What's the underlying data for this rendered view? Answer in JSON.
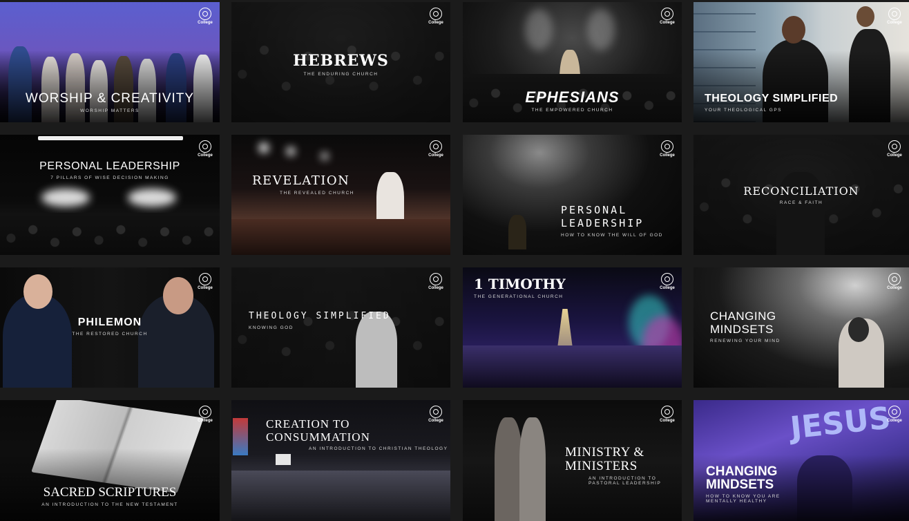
{
  "logo": {
    "label": "College"
  },
  "cards": [
    {
      "title": "WORSHIP & CREATIVITY",
      "subtitle": "WORSHIP MATTERS"
    },
    {
      "title": "HEBREWS",
      "subtitle": "THE ENDURING CHURCH"
    },
    {
      "title": "EPHESIANS",
      "subtitle": "THE EMPOWERED CHURCH"
    },
    {
      "title": "THEOLOGY SIMPLIFIED",
      "subtitle": "YOUR THEOLOGICAL GPS"
    },
    {
      "title": "PERSONAL LEADERSHIP",
      "subtitle": "7 PILLARS OF WISE DECISION MAKING"
    },
    {
      "title": "REVELATION",
      "subtitle": "THE REVEALED CHURCH"
    },
    {
      "title": "PERSONAL LEADERSHIP",
      "subtitle": "HOW TO KNOW THE WILL OF GOD"
    },
    {
      "title": "RECONCILIATION",
      "subtitle": "RACE & FAITH"
    },
    {
      "title": "PHILEMON",
      "subtitle": "THE RESTORED CHURCH"
    },
    {
      "title": "THEOLOGY SIMPLIFIED",
      "subtitle": "KNOWING GOD"
    },
    {
      "title": "1 TIMOTHY",
      "subtitle": "THE GENERATIONAL CHURCH"
    },
    {
      "title": "CHANGING MINDSETS",
      "subtitle": "RENEWING YOUR MIND"
    },
    {
      "title": "SACRED SCRIPTURES",
      "subtitle": "AN INTRODUCTION TO THE NEW TESTAMENT"
    },
    {
      "title": "CREATION TO CONSUMMATION",
      "subtitle": "AN INTRODUCTION TO CHRISTIAN THEOLOGY"
    },
    {
      "title": "MINISTRY & MINISTERS",
      "subtitle": "AN INTRODUCTION TO PASTORAL LEADERSHIP"
    },
    {
      "title": "CHANGING MINDSETS",
      "subtitle": "HOW TO KNOW YOU ARE MENTALLY HEALTHY",
      "background_text": "JESUS"
    }
  ],
  "colors": {
    "page_background": "#1b1b1b",
    "card_background": "#0b0b0b",
    "accent_purple": "#7a55d6",
    "accent_teal": "#35d0c8",
    "accent_magenta": "#c23aa8",
    "spot_yellow": "#ffe7a0"
  }
}
